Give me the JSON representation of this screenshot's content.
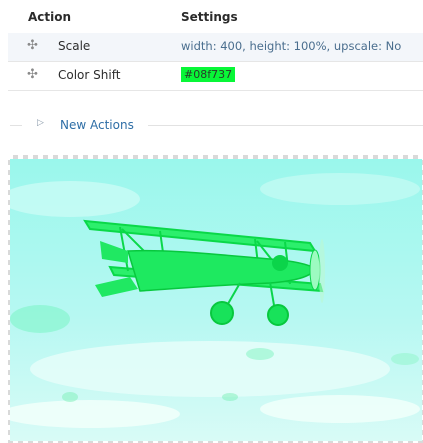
{
  "table": {
    "headers": {
      "action": "Action",
      "settings": "Settings"
    },
    "rows": [
      {
        "action": "Scale",
        "settings": "width: 400, height: 100%, upscale: No",
        "drag_icon": "drag-handle-icon"
      },
      {
        "action": "Color Shift",
        "swatch_label": "#08f737",
        "swatch_color": "#08f737",
        "drag_icon": "drag-handle-icon"
      }
    ]
  },
  "new_actions": {
    "label": "New Actions",
    "icon": "triangle-right-icon"
  },
  "preview": {
    "subject": "biplane",
    "tint": "#08f737"
  }
}
